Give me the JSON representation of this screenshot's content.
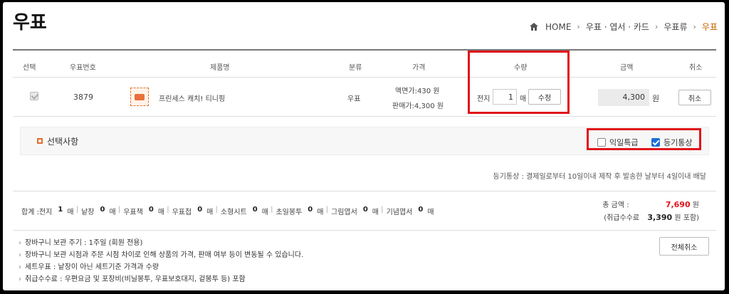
{
  "page": {
    "title": "우표"
  },
  "breadcrumb": [
    "HOME",
    "우표 · 엽서 · 카드",
    "우표류",
    "우표"
  ],
  "table": {
    "headers": [
      "선택",
      "우표번호",
      "제품명",
      "분류",
      "가격",
      "수량",
      "금액",
      "취소"
    ],
    "row": {
      "number": "3879",
      "product_name": "프린세스 캐치! 티니핑",
      "category": "우표",
      "face_value": "액면가:430 원",
      "sale_price": "판매가:4,300 원",
      "qty_label": "전지",
      "qty_value": "1",
      "qty_unit": "매",
      "update_label": "수정",
      "amount": "4,300",
      "amount_unit": "원",
      "cancel_label": "취소"
    }
  },
  "options": {
    "title": "선택사항",
    "express_label": "익일특급",
    "express_checked": false,
    "registered_label": "등기통상",
    "registered_checked": true
  },
  "note": "등기통상 : 결제일로부터 10일이내 제작 후 발송한 날부터 4일이내 배달",
  "summary": {
    "label": "합계 : ",
    "items": [
      {
        "name": "전지",
        "count": "1",
        "unit": "매"
      },
      {
        "name": "낱장",
        "count": "0",
        "unit": "매"
      },
      {
        "name": "우표책",
        "count": "0",
        "unit": "매"
      },
      {
        "name": "우표첩",
        "count": "0",
        "unit": "매"
      },
      {
        "name": "소형시트",
        "count": "0",
        "unit": "매"
      },
      {
        "name": "초일봉투",
        "count": "0",
        "unit": "매"
      },
      {
        "name": "그림엽서",
        "count": "0",
        "unit": "매"
      },
      {
        "name": "기념엽서",
        "count": "0",
        "unit": "매"
      }
    ],
    "total_label": "총 금액 :",
    "total_value": "7,690",
    "total_unit": "원",
    "fee_label": "(취급수수료",
    "fee_value": "3,390",
    "fee_unit": "원 포함)"
  },
  "notices": [
    "장바구니 보관 주기 : 1주일 (회원 전용)",
    "장바구니 보관 시점과 주문 시점 차이로 인해 상품의 가격, 판매 여부 등이 변동될 수 있습니다.",
    "세트우표 : 낱장이 아닌 세트기준 가격과 수량",
    "취급수수료 : 우편요금 및 포장비(비닐봉투, 우표보호대지, 겉봉투 등) 포함"
  ],
  "clear_all_label": "전체취소",
  "colors": {
    "highlight": "#e0131b",
    "accent": "#c86400",
    "checkbox": "#1a6fd8"
  }
}
